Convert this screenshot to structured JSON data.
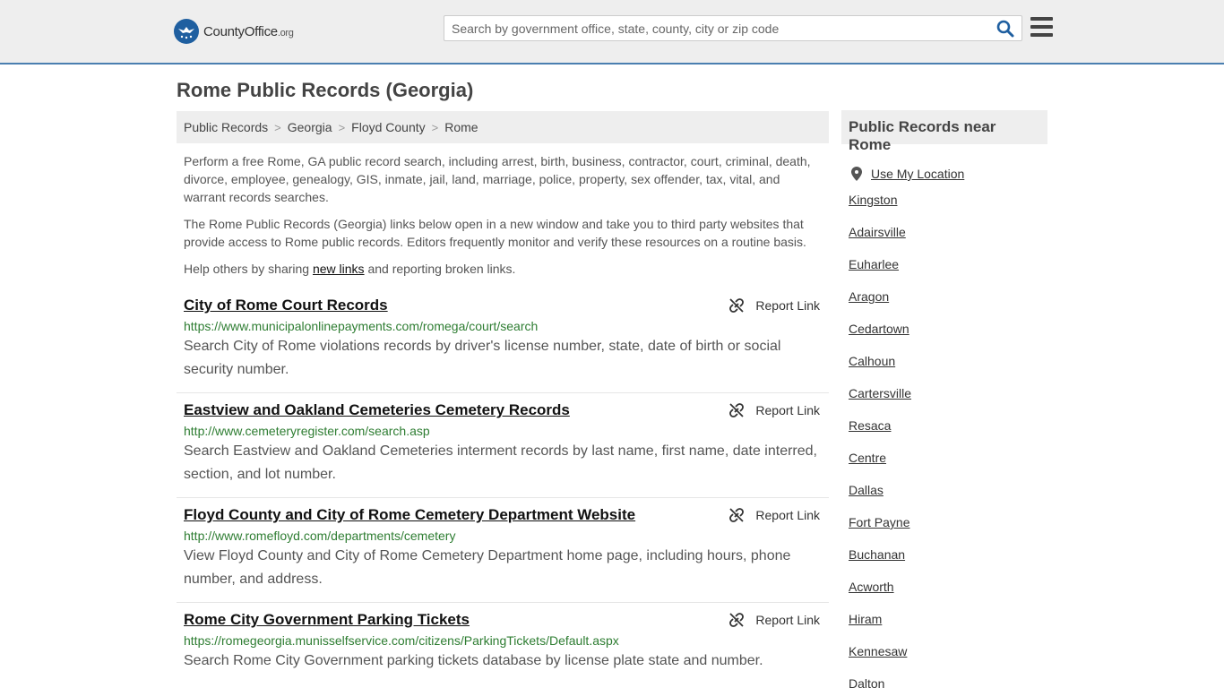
{
  "header": {
    "logo_text": "CountyOffice",
    "logo_tld": ".org",
    "search_placeholder": "Search by government office, state, county, city or zip code"
  },
  "page_title": "Rome Public Records (Georgia)",
  "breadcrumb": [
    "Public Records",
    "Georgia",
    "Floyd County",
    "Rome"
  ],
  "intro": {
    "p1": "Perform a free Rome, GA public record search, including arrest, birth, business, contractor, court, criminal, death, divorce, employee, genealogy, GIS, inmate, jail, land, marriage, police, property, sex offender, tax, vital, and warrant records searches.",
    "p2": "The Rome Public Records (Georgia) links below open in a new window and take you to third party websites that provide access to Rome public records. Editors frequently monitor and verify these resources on a routine basis.",
    "p3_before": "Help others by sharing ",
    "p3_link": "new links",
    "p3_after": " and reporting broken links."
  },
  "report_label": "Report Link",
  "records": [
    {
      "title": "City of Rome Court Records",
      "url": "https://www.municipalonlinepayments.com/romega/court/search",
      "desc": "Search City of Rome violations records by driver's license number, state, date of birth or social security number."
    },
    {
      "title": "Eastview and Oakland Cemeteries Cemetery Records",
      "url": "http://www.cemeteryregister.com/search.asp",
      "desc": "Search Eastview and Oakland Cemeteries interment records by last name, first name, date interred, section, and lot number."
    },
    {
      "title": "Floyd County and City of Rome Cemetery Department Website",
      "url": "http://www.romefloyd.com/departments/cemetery",
      "desc": "View Floyd County and City of Rome Cemetery Department home page, including hours, phone number, and address."
    },
    {
      "title": "Rome City Government Parking Tickets",
      "url": "https://romegeorgia.munisselfservice.com/citizens/ParkingTickets/Default.aspx",
      "desc": "Search Rome City Government parking tickets database by license plate state and number."
    }
  ],
  "sidebar": {
    "title": "Public Records near Rome",
    "use_location": "Use My Location",
    "cities": [
      "Kingston",
      "Adairsville",
      "Euharlee",
      "Aragon",
      "Cedartown",
      "Calhoun",
      "Cartersville",
      "Resaca",
      "Centre",
      "Dallas",
      "Fort Payne",
      "Buchanan",
      "Acworth",
      "Hiram",
      "Kennesaw",
      "Dalton"
    ]
  }
}
